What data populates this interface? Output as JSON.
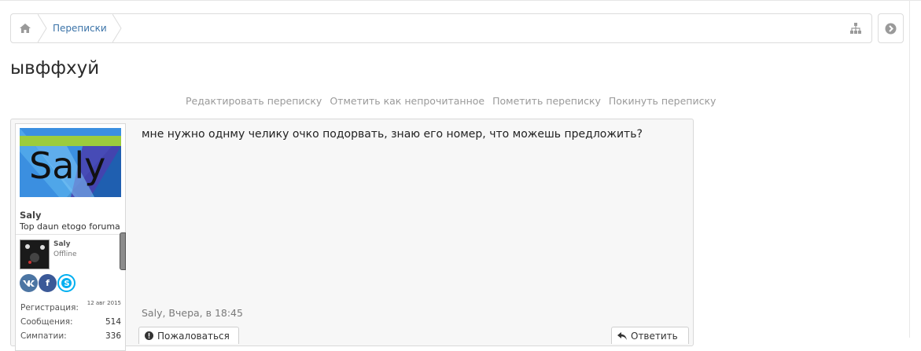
{
  "breadcrumb": {
    "items": [
      "Переписки"
    ]
  },
  "conversation": {
    "title": "ывффхуй",
    "actions": [
      "Редактировать переписку",
      "Отметить как непрочитанное",
      "Пометить переписку",
      "Покинуть переписку"
    ]
  },
  "message": {
    "text": "мне нужно однму челику очко подорвать, знаю его номер, что можешь предложить?",
    "author": "Saly",
    "author_title": "Top daun etogo foruma",
    "meta": "Saly, Вчера, в 18:45",
    "report_label": "Пожаловаться",
    "reply_label": "Ответить"
  },
  "userinfo": {
    "avatar_text": "Saly",
    "mini_name": "Saly",
    "mini_status": "Offline",
    "socials": [
      "vk",
      "f",
      "skype"
    ],
    "stats": [
      {
        "label": "Регистрация:",
        "value": "12 авг 2015"
      },
      {
        "label": "Сообщения:",
        "value": "514"
      },
      {
        "label": "Симпатии:",
        "value": "336"
      }
    ]
  },
  "colors": {
    "link": "#3b73a8",
    "vk": "#4c75a3",
    "facebook": "#3b5998",
    "skype": "#00aff0"
  }
}
